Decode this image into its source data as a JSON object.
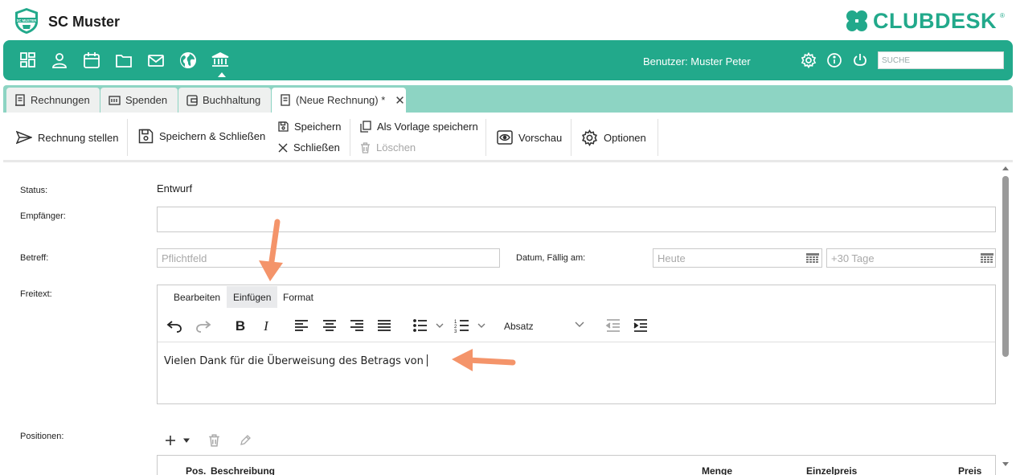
{
  "header": {
    "club_name": "SC Muster",
    "logo_text": "SC MUSTER",
    "brand": "CLUBDESK",
    "brand_mark": "®"
  },
  "nav": {
    "icons": [
      "dashboard-icon",
      "person-icon",
      "calendar-icon",
      "folder-icon",
      "mail-icon",
      "globe-icon",
      "bank-icon"
    ],
    "user_label": "Benutzer: Muster Peter",
    "search_placeholder": "SUCHE"
  },
  "tabs": [
    {
      "label": "Rechnungen",
      "icon": "invoice-icon"
    },
    {
      "label": "Spenden",
      "icon": "donation-icon"
    },
    {
      "label": "Buchhaltung",
      "icon": "ledger-icon"
    },
    {
      "label": "(Neue Rechnung) *",
      "icon": "invoice-icon",
      "active": true,
      "close": "✕"
    }
  ],
  "toolbar": {
    "issue_invoice": "Rechnung stellen",
    "save_close": "Speichern & Schließen",
    "save": "Speichern",
    "close": "Schließen",
    "save_template": "Als Vorlage speichern",
    "delete": "Löschen",
    "preview": "Vorschau",
    "options": "Optionen"
  },
  "form": {
    "status_label": "Status:",
    "status_value": "Entwurf",
    "recipient_label": "Empfänger:",
    "recipient_value": "",
    "subject_label": "Betreff:",
    "subject_placeholder": "Pflichtfeld",
    "date_label": "Datum, Fällig am:",
    "date_placeholder": "Heute",
    "due_placeholder": "+30 Tage",
    "freetext_label": "Freitext:",
    "positions_label": "Positionen:"
  },
  "editor": {
    "menu": [
      "Bearbeiten",
      "Einfügen",
      "Format"
    ],
    "highlighted_menu": "Einfügen",
    "block_format": "Absatz",
    "content": "Vielen Dank für die Überweisung des Betrags von"
  },
  "positions_table": {
    "columns": [
      "Pos.",
      "Beschreibung",
      "Menge",
      "Einzelpreis",
      "Preis"
    ]
  },
  "colors": {
    "brand_green": "#22a98b",
    "tab_bar": "#8dd4c3",
    "annotation_arrow": "#f4946a"
  }
}
